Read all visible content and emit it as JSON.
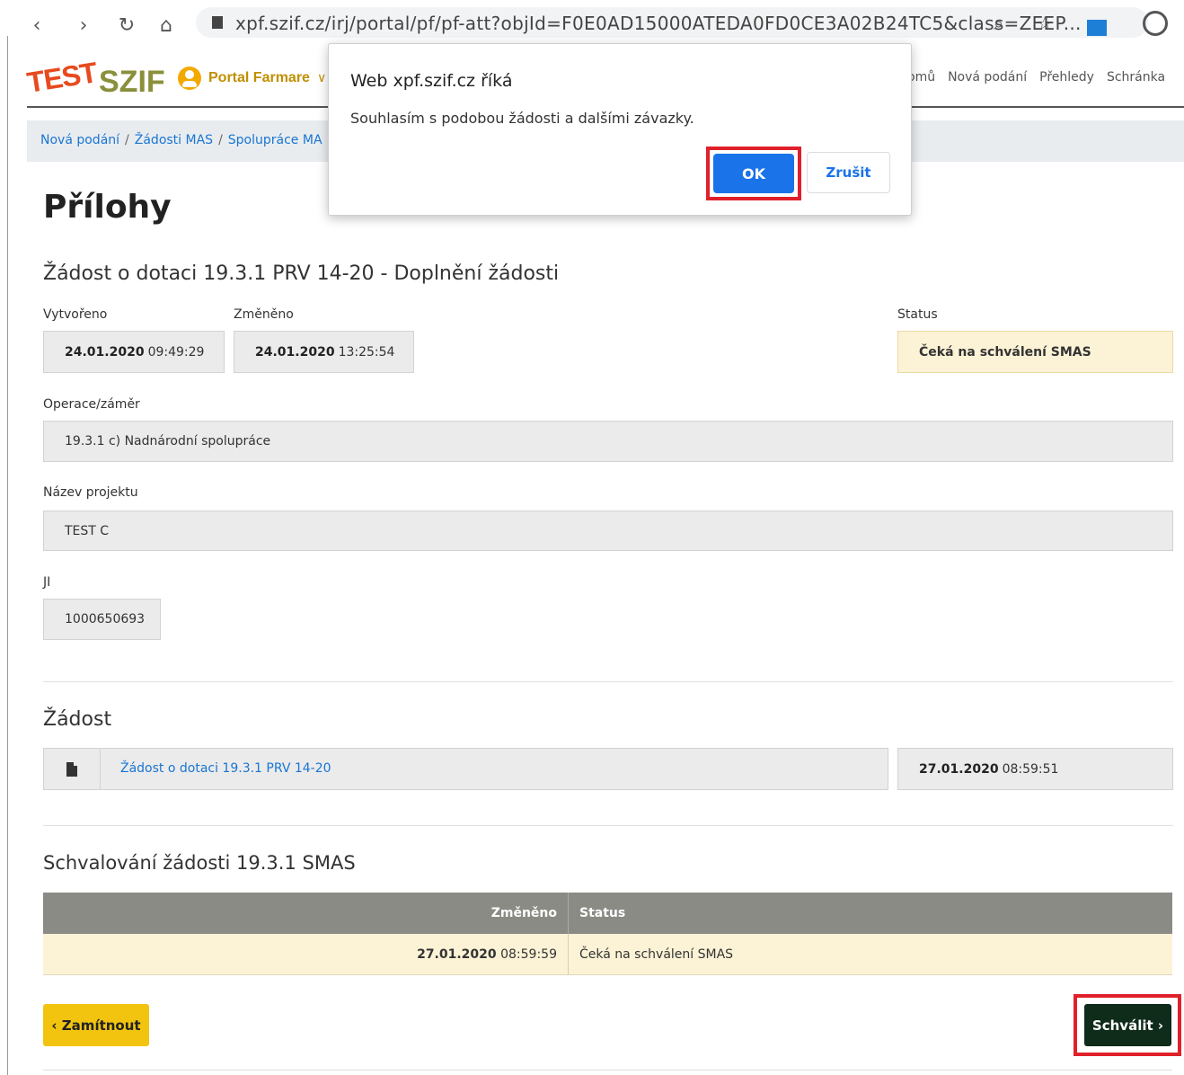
{
  "browser": {
    "url": "xpf.szif.cz/irj/portal/pf/pf-att?objId=F0E0AD15000ATEDA0FD0CE3A02B24TC5&class=ZEEP...",
    "back_icon": "back-arrow-icon",
    "forward_icon": "forward-arrow-icon",
    "reload_icon": "reload-icon",
    "home_icon": "home-icon"
  },
  "header": {
    "logo_test": "TEST",
    "logo_szif": "SZIF",
    "portal_label": "Portal Farmare",
    "nav": [
      "omů",
      "Nová podání",
      "Přehledy",
      "Schránka"
    ]
  },
  "breadcrumb": {
    "items": [
      "Nová podání",
      "Žádosti MAS",
      "Spolupráce MA"
    ],
    "separator": "/"
  },
  "page": {
    "title": "Přílohy",
    "subtitle": "Žádost o dotaci 19.3.1 PRV 14-20 - Doplnění žádosti"
  },
  "fields": {
    "created_label": "Vytvořeno",
    "created_date": "24.01.2020",
    "created_time": "09:49:29",
    "changed_label": "Změněno",
    "changed_date": "24.01.2020",
    "changed_time": "13:25:54",
    "status_label": "Status",
    "status_value": "Čeká na schválení SMAS",
    "operation_label": "Operace/záměr",
    "operation_value": "19.3.1 c) Nadnárodní spolupráce",
    "project_label": "Název projektu",
    "project_value": "TEST C",
    "ji_label": "JI",
    "ji_value": "1000650693"
  },
  "request": {
    "heading": "Žádost",
    "doc_link": "Žádost o dotaci 19.3.1 PRV 14-20",
    "doc_date": "27.01.2020",
    "doc_time": "08:59:51"
  },
  "approval": {
    "heading": "Schvalování žádosti 19.3.1 SMAS",
    "columns": [
      "Změněno",
      "Status"
    ],
    "rows": [
      {
        "date": "27.01.2020",
        "time": "08:59:59",
        "status": "Čeká na schválení SMAS"
      }
    ]
  },
  "buttons": {
    "reject": "‹ Zamítnout",
    "approve": "Schválit ›"
  },
  "dialog": {
    "title": "Web xpf.szif.cz říká",
    "message": "Souhlasím s podobou žádosti a dalšími závazky.",
    "ok": "OK",
    "cancel": "Zrušit"
  },
  "colors": {
    "highlight": "#e0202a",
    "primary_blue": "#1a73e8",
    "status_bg": "#fcf3d6",
    "reject_bg": "#f2c40f",
    "approve_bg": "#0f2b1a"
  }
}
